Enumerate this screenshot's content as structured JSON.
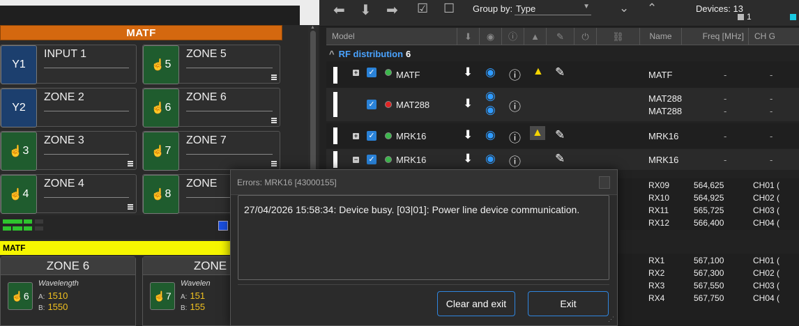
{
  "left": {
    "matf_header": "MATF",
    "zones": [
      {
        "icon": "Y1",
        "label": "INPUT 1",
        "kind": "filter"
      },
      {
        "icon": "5",
        "label": "ZONE 5",
        "kind": "zone"
      },
      {
        "icon": "Y2",
        "label": "ZONE 2",
        "kind": "filter"
      },
      {
        "icon": "6",
        "label": "ZONE 6",
        "kind": "zone"
      },
      {
        "icon": "3",
        "label": "ZONE 3",
        "kind": "zone"
      },
      {
        "icon": "7",
        "label": "ZONE 7",
        "kind": "zone"
      },
      {
        "icon": "4",
        "label": "ZONE 4",
        "kind": "zone"
      },
      {
        "icon": "8",
        "label": "ZONE",
        "kind": "zone"
      }
    ],
    "matf_bar": "MATF",
    "cards": [
      {
        "title": "ZONE 6",
        "icon": "6",
        "wavelength_label": "Wavelength",
        "a_key": "A:",
        "a": "1510",
        "b_key": "B:",
        "b": "1550"
      },
      {
        "title": "ZONE",
        "icon": "7",
        "wavelength_label": "Wavelen",
        "a_key": "A:",
        "a": "151",
        "b_key": "B:",
        "b": "155"
      }
    ]
  },
  "toolbar": {
    "group_by_label": "Group by:",
    "group_by_value": "Type",
    "devices_label": "Devices: 13",
    "status_count_1": "1"
  },
  "table": {
    "headers": {
      "model": "Model",
      "name": "Name",
      "freq": "Freq [MHz]",
      "ch": "CH G"
    },
    "group": {
      "name": "RF distribution",
      "count": "6"
    },
    "rows": [
      {
        "model": "MATF",
        "name": "MATF",
        "led": "g",
        "warn": true,
        "pencil": true,
        "expand": "+",
        "dual": false
      },
      {
        "model": "MAT288",
        "name": "MAT288",
        "name2": "MAT288",
        "led": "r",
        "warn": false,
        "pencil": false,
        "expand": "",
        "dual": true
      },
      {
        "model": "MRK16",
        "name": "MRK16",
        "led": "g",
        "warn": true,
        "pencil": true,
        "expand": "+",
        "dual": false
      },
      {
        "model": "MRK16",
        "name": "MRK16",
        "led": "g",
        "warn": false,
        "pencil": true,
        "expand": "-",
        "dual": false
      }
    ],
    "dash": "-",
    "sub1": [
      {
        "name": "RX09",
        "freq": "564,625",
        "ch": "CH01 ("
      },
      {
        "name": "RX10",
        "freq": "564,925",
        "ch": "CH02 ("
      },
      {
        "name": "RX11",
        "freq": "565,725",
        "ch": "CH03 ("
      },
      {
        "name": "RX12",
        "freq": "566,400",
        "ch": "CH04 ("
      }
    ],
    "sub2": [
      {
        "name": "RX1",
        "freq": "567,100",
        "ch": "CH01 ("
      },
      {
        "name": "RX2",
        "freq": "567,300",
        "ch": "CH02 ("
      },
      {
        "name": "RX3",
        "freq": "567,550",
        "ch": "CH03 ("
      },
      {
        "name": "RX4",
        "freq": "567,750",
        "ch": "CH04 ("
      }
    ]
  },
  "dialog": {
    "title": "Errors: MRK16 [43000155]",
    "message": "27/04/2026 15:58:34: Device busy. [03|01]: Power line device communication.",
    "clear_label": "Clear and exit",
    "exit_label": "Exit"
  },
  "colors": {
    "matf_orange": "#d4680f",
    "matf_yellow": "#f6f600",
    "zone_green": "#1f5c2e",
    "accent_blue": "#2f86e0",
    "eye_blue": "#2f9bff",
    "warn_yellow": "#f5d400"
  }
}
